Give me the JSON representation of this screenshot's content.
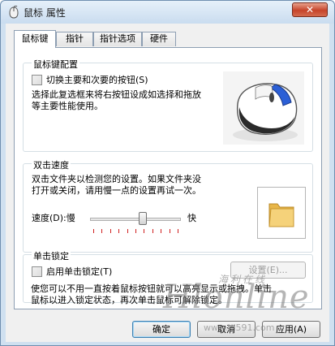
{
  "window": {
    "title": "鼠标 属性",
    "close_label": "✕"
  },
  "tabs": [
    {
      "label": "鼠标键",
      "active": true
    },
    {
      "label": "指针",
      "active": false
    },
    {
      "label": "指针选项",
      "active": false
    },
    {
      "label": "硬件",
      "active": false
    }
  ],
  "button_config": {
    "group_label": "鼠标键配置",
    "switch_checkbox_label": "切换主要和次要的按钮(S)",
    "switch_checked": false,
    "description_line1": "选择此复选框来将右按钮设成如选择和拖放",
    "description_line2": "等主要性能使用。"
  },
  "double_click": {
    "group_label": "双击速度",
    "description_line1": "双击文件夹以检测您的设置。如果文件夹没",
    "description_line2": "打开或关闭，请用慢一点的设置再试一次。",
    "speed_label": "速度(D):慢",
    "fast_label": "快",
    "slider_value": 0.58
  },
  "click_lock": {
    "group_label": "单击锁定",
    "checkbox_label": "启用单击锁定(T)",
    "checked": false,
    "settings_button": "设置(E)...",
    "description_line1": "使您可以不用一直按着鼠标按钮就可以高亮显示或拖拽。单击",
    "description_line2": "鼠标以进入锁定状态，再次单击鼠标可解除锁定。"
  },
  "footer": {
    "ok": "确定",
    "cancel": "取消",
    "apply": "应用(A)"
  },
  "watermark": {
    "brand": "Hlonline",
    "chinese": "海利在线",
    "url": "www.hl591.com"
  }
}
